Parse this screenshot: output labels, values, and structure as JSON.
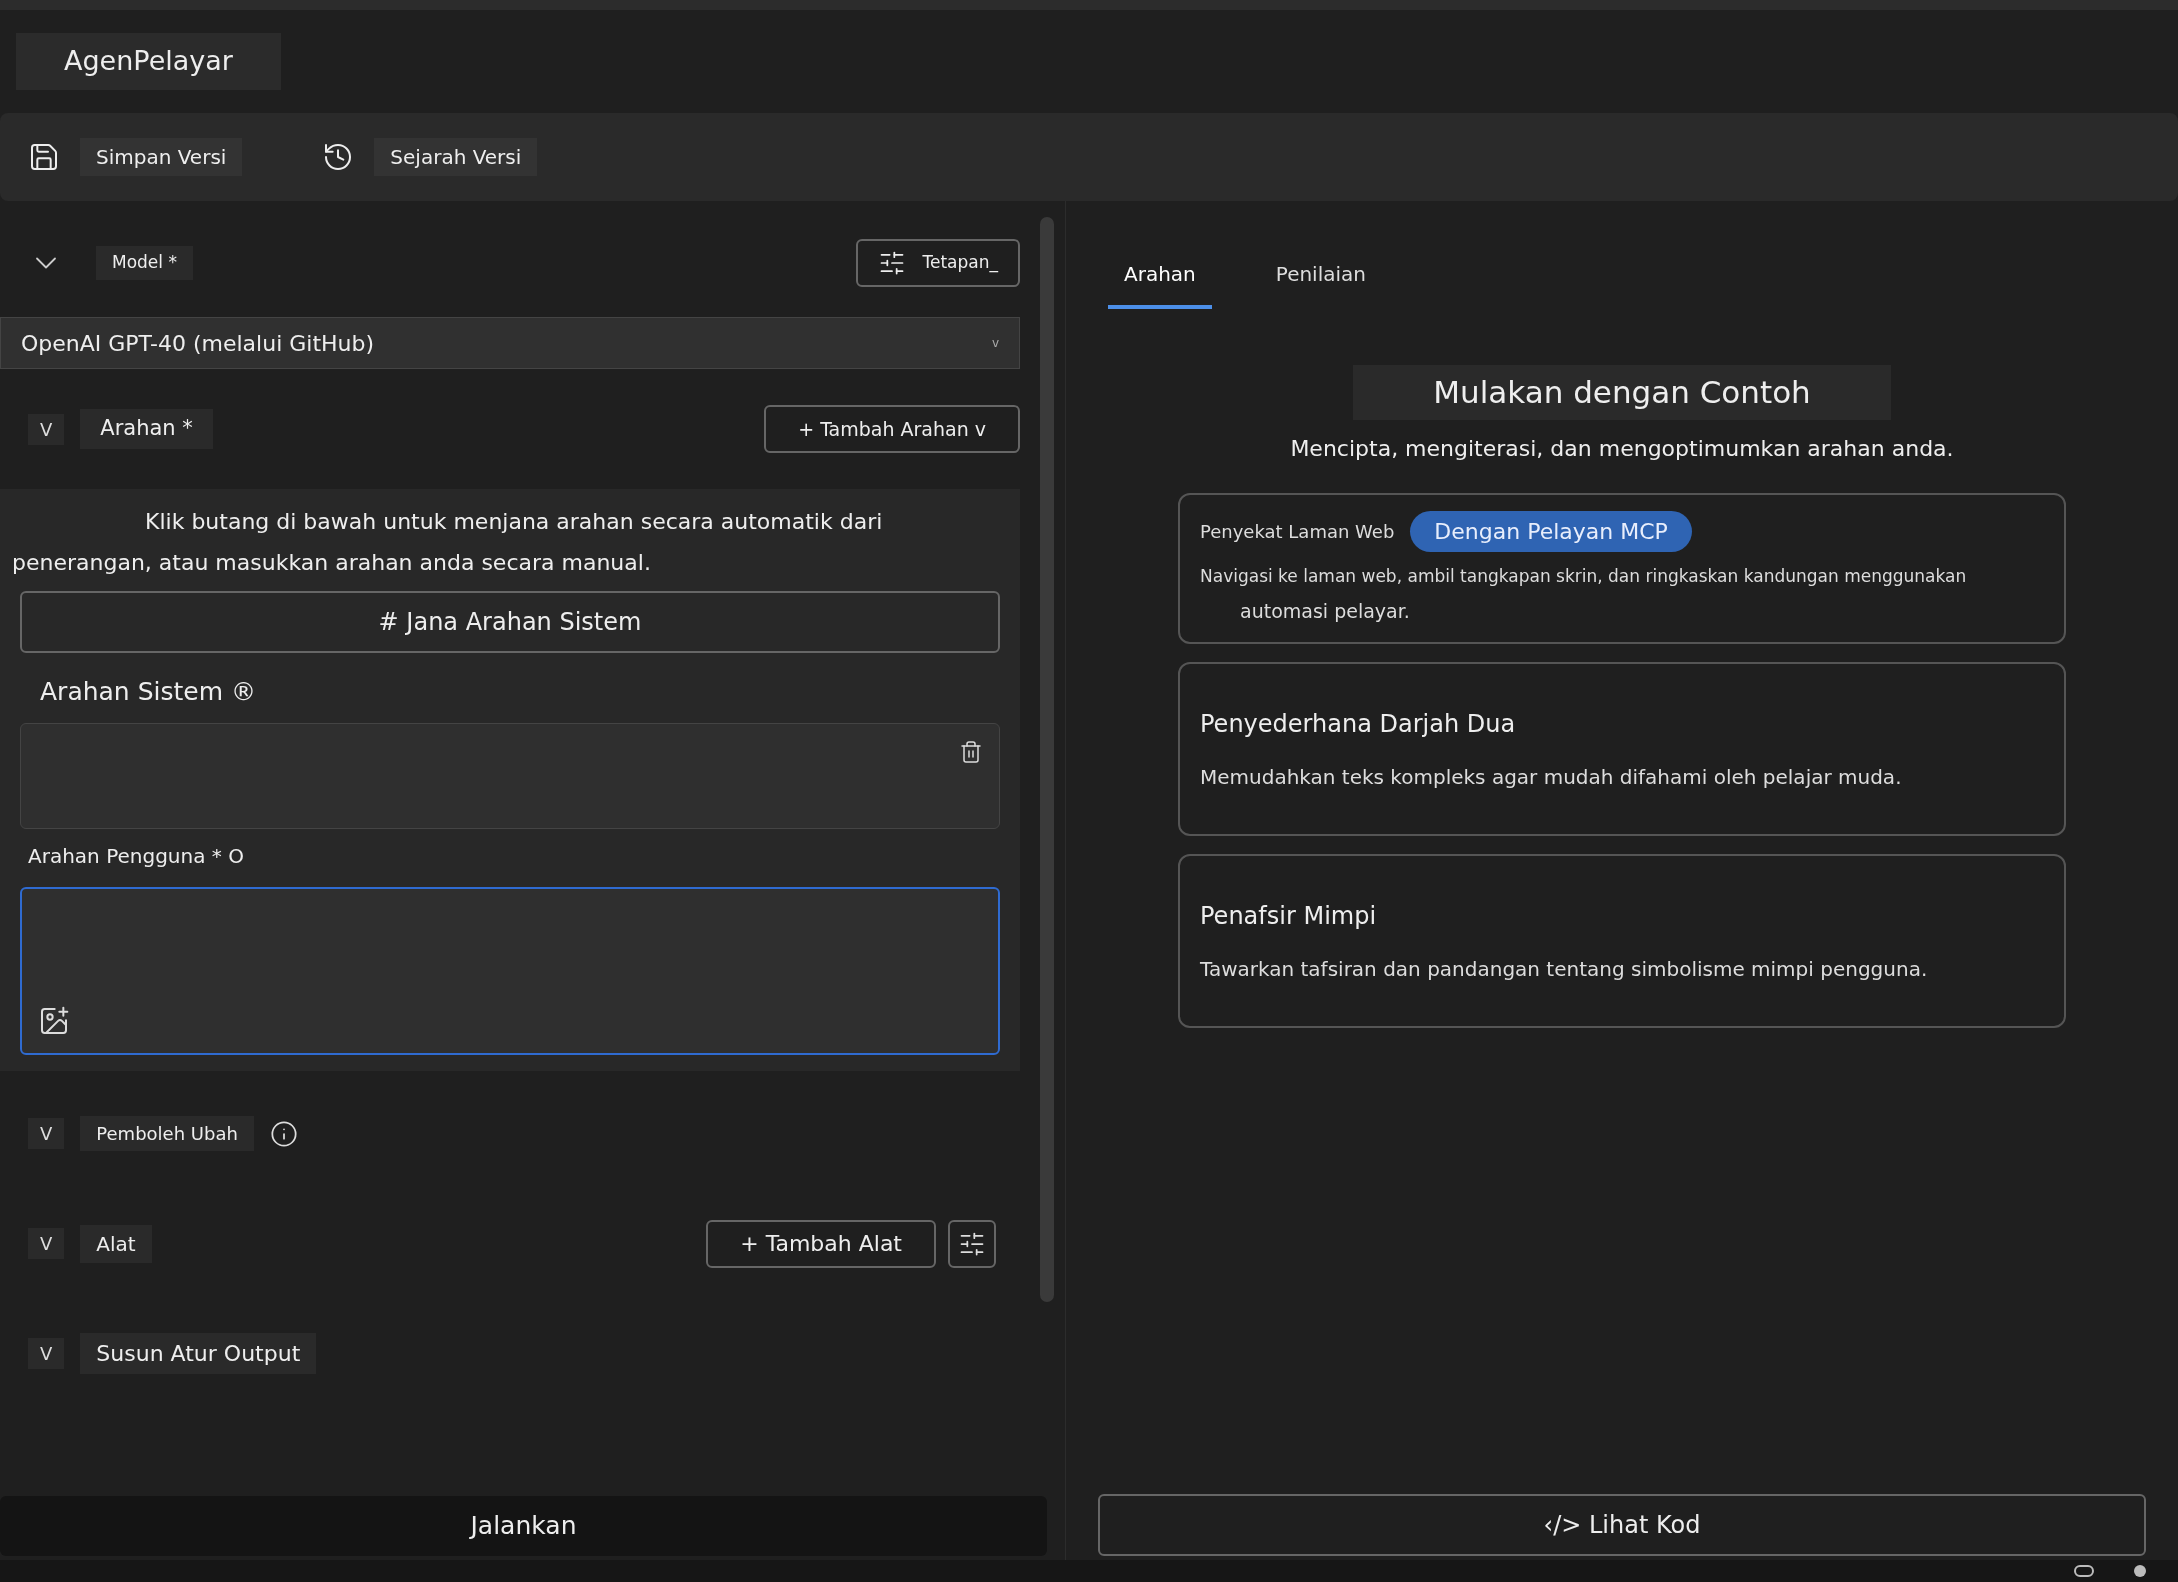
{
  "app_title": "AgenPelayar",
  "toolbar": [
    {
      "kind": "save",
      "label": "Simpan Versi"
    },
    {
      "kind": "history",
      "label": "Sejarah Versi"
    }
  ],
  "model": {
    "label": "Model *",
    "settings_button": "Tetapan_",
    "value": "OpenAI GPT-40 (melalui GitHub)",
    "dropdown_mark": "v"
  },
  "prompt": {
    "toggle": "V",
    "label": "Arahan *",
    "add_button": "+ Tambah Arahan v",
    "help": "Klik butang di bawah untuk menjana arahan secara automatik dari",
    "help_2": "penerangan, atau masukkan arahan anda secara manual.",
    "generate_button": "# Jana Arahan Sistem",
    "system_label": "Arahan Sistem ®",
    "user_label": "Arahan Pengguna * O",
    "user_focused": true
  },
  "sections": [
    {
      "kind": "variables",
      "toggle": "V",
      "label": "Pemboleh Ubah"
    },
    {
      "kind": "tools",
      "toggle": "V",
      "label": "Alat",
      "add_button": "+ Tambah Alat"
    },
    {
      "kind": "output",
      "toggle": "V",
      "label": "Susun Atur Output"
    }
  ],
  "run_button": "Jalankan",
  "tabs": [
    {
      "label": "Arahan",
      "selected": true
    },
    {
      "label": "Penilaian",
      "selected": false
    }
  ],
  "examples": {
    "heading": "Mulakan dengan Contoh",
    "subtitle": "Mencipta, mengiterasi, dan mengoptimumkan arahan anda.",
    "cards": [
      {
        "kind": "tagged",
        "tag": "Penyekat Laman Web",
        "badge": "Dengan Pelayan MCP",
        "description": "Navigasi ke laman web, ambil tangkapan skrin, dan ringkaskan kandungan menggunakan",
        "description_2": "automasi pelayar."
      },
      {
        "kind": "plain",
        "title": "Penyederhana Darjah Dua",
        "description": "Memudahkan teks kompleks agar mudah difahami oleh pelajar muda."
      },
      {
        "kind": "plain",
        "title": "Penafsir Mimpi",
        "description": "Tawarkan tafsiran dan pandangan tentang simbolisme mimpi pengguna."
      }
    ]
  },
  "view_code_button": "‹/> Lihat Kod"
}
